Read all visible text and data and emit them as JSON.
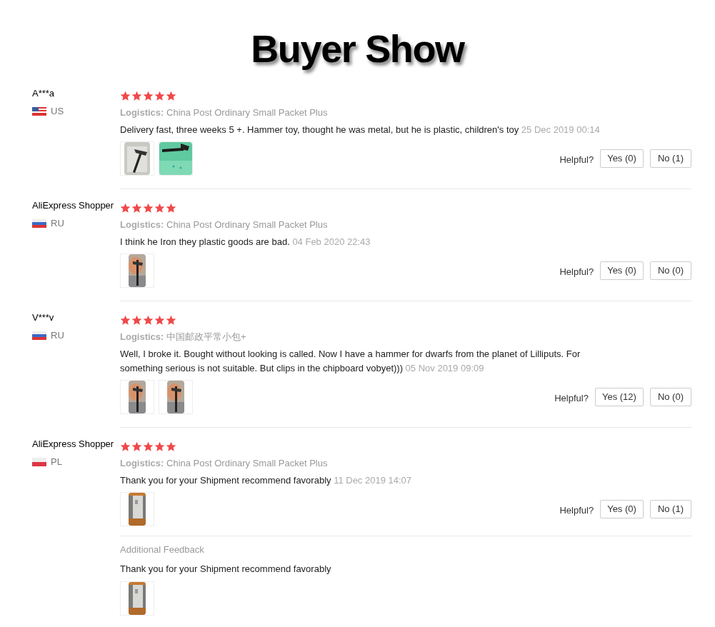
{
  "title": "Buyer Show",
  "reviews": [
    {
      "name": "A***a",
      "flag": {
        "kind": "us"
      },
      "country": "US",
      "stars": 5,
      "logistics_label": "Logistics:",
      "logistics": "China Post Ordinary Small Packet Plus",
      "comment": "Delivery fast, three weeks 5 +. Hammer toy, thought he was metal, but he is plastic, children's toy",
      "date": "25 Dec 2019 00:14",
      "photos": [
        {
          "kind": "picture"
        },
        {
          "kind": "picture"
        }
      ],
      "helpful": "Helpful?",
      "yes": "Yes (0)",
      "no": "No (1)"
    },
    {
      "name": "AliExpress Shopper",
      "flag": {
        "kind": "ru"
      },
      "country": "RU",
      "stars": 5,
      "logistics_label": "Logistics:",
      "logistics": "China Post Ordinary Small Packet Plus",
      "comment": "I think he Iron they plastic goods are bad.",
      "date": "04 Feb 2020 22:43",
      "photos": [
        {
          "kind": "picture"
        }
      ],
      "helpful": "Helpful?",
      "yes": "Yes (0)",
      "no": "No (0)"
    },
    {
      "name": "V***v",
      "flag": {
        "kind": "ru"
      },
      "country": "RU",
      "stars": 5,
      "logistics_label": "Logistics:",
      "logistics": "中国邮政平常小包+",
      "comment": "Well, I broke it. Bought without looking is called. Now I have a hammer for dwarfs from the planet of Lilliputs. For something serious is not suitable. But clips in the chipboard vobyet)))",
      "date": "05 Nov 2019 09:09",
      "photos": [
        {
          "kind": "picture"
        },
        {
          "kind": "picture"
        }
      ],
      "helpful": "Helpful?",
      "yes": "Yes (12)",
      "no": "No (0)"
    },
    {
      "name": "AliExpress Shopper",
      "flag": {
        "kind": "pl"
      },
      "country": "PL",
      "stars": 5,
      "logistics_label": "Logistics:",
      "logistics": "China Post Ordinary Small Packet Plus",
      "comment": "Thank you for your Shipment recommend favorably",
      "date": "11 Dec 2019 14:07",
      "photos": [
        {
          "kind": "picture"
        }
      ],
      "helpful": "Helpful?",
      "yes": "Yes (0)",
      "no": "No (1)",
      "additional": {
        "label": "Additional Feedback",
        "comment": "Thank you for your Shipment recommend favorably",
        "photos": [
          {
            "kind": "picture"
          }
        ]
      }
    }
  ]
}
